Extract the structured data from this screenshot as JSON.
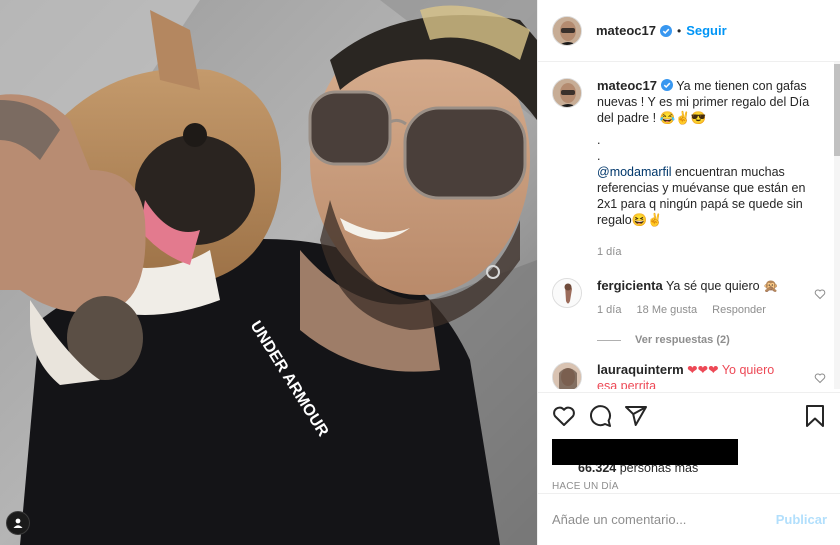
{
  "post": {
    "username": "mateoc17",
    "follow_label": "Seguir",
    "dot": "•",
    "caption": {
      "line1": "Ya me tienen con gafas nuevas ! Y es mi primer regalo del Día del padre ! 😂✌😎",
      "dot1": ".",
      "dot2": ".",
      "mention": "@modamarfil",
      "line2": " encuentran muchas referencias y muévanse que están en 2x1 para q ningún papá se quede sin regalo😆✌",
      "time": "1 día"
    },
    "comments": [
      {
        "username": "fergicienta",
        "text": "Ya sé que quiero 🙊",
        "time": "1 día",
        "likes": "18 Me gusta",
        "reply_label": "Responder",
        "view_replies": "Ver respuestas (2)"
      },
      {
        "username": "lauraquinterm",
        "text": "❤❤❤ Yo quiero esa perrita"
      }
    ],
    "likes_count": "66.324",
    "likes_suffix": " personas más",
    "timestamp": "HACE UN DÍA",
    "comment_placeholder": "Añade un comentario...",
    "publish_label": "Publicar"
  },
  "colors": {
    "accent": "#0095f6",
    "publish_disabled": "#b2dffc",
    "muted": "#8e8e8e",
    "text": "#262626"
  },
  "icons": {
    "verified": "verified-badge-icon",
    "like": "heart-icon",
    "comment": "comment-bubble-icon",
    "share": "paper-plane-icon",
    "save": "bookmark-icon",
    "media_user": "user-icon"
  }
}
